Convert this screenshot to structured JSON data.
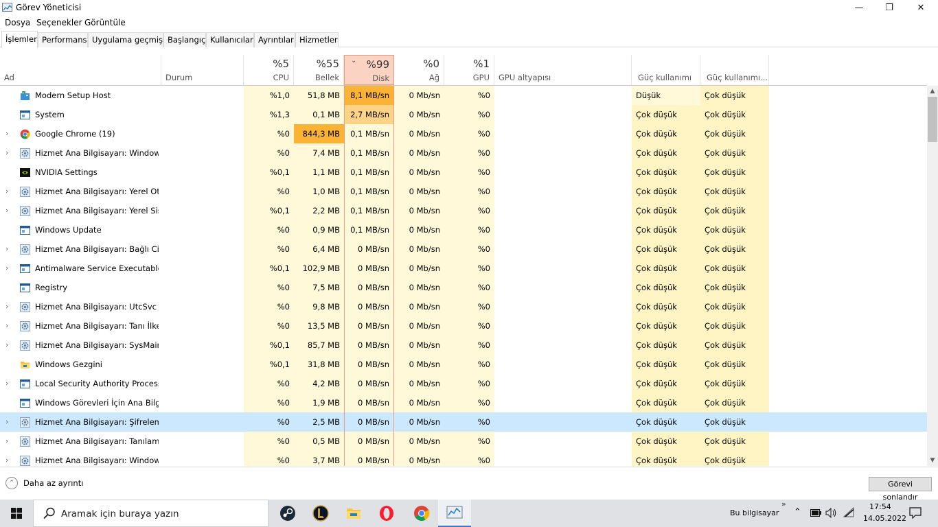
{
  "window": {
    "title": "Görev Yöneticisi",
    "minimize_glyph": "—",
    "maximize_glyph": "❐",
    "close_glyph": "✕"
  },
  "menu": [
    "Dosya",
    "Seçenekler",
    "Görüntüle"
  ],
  "tabs": [
    "İşlemler",
    "Performans",
    "Uygulama geçmişi",
    "Başlangıç",
    "Kullanıcılar",
    "Ayrıntılar",
    "Hizmetler"
  ],
  "active_tab": "İşlemler",
  "columns": {
    "name": "Ad",
    "status": "Durum",
    "cpu": {
      "pct": "%5",
      "label": "CPU"
    },
    "memory": {
      "pct": "%55",
      "label": "Bellek"
    },
    "disk": {
      "pct": "%99",
      "label": "Disk"
    },
    "network": {
      "pct": "%0",
      "label": "Ağ"
    },
    "gpu": {
      "pct": "%1",
      "label": "GPU"
    },
    "gpu_engine": "GPU altyapısı",
    "power": "Güç kullanımı",
    "power_trend": "Güç kullanımı..."
  },
  "rows": [
    {
      "name": "Modern Setup Host",
      "icon": "setup-icon",
      "expandable": false,
      "cpu": "%1,0",
      "mem": "51,8 MB",
      "disk": "8,1 MB/sn",
      "net": "0 Mb/sn",
      "gpu": "%0",
      "power": "Düşük",
      "trend": "Çok düşük",
      "disk_level": "high",
      "mem_level": "low",
      "power_level": "low"
    },
    {
      "name": "System",
      "icon": "window-icon",
      "expandable": false,
      "cpu": "%1,3",
      "mem": "0,1 MB",
      "disk": "2,7 MB/sn",
      "net": "0 Mb/sn",
      "gpu": "%0",
      "power": "Çok düşük",
      "trend": "Çok düşük",
      "disk_level": "mid",
      "mem_level": "low",
      "power_level": "verylow"
    },
    {
      "name": "Google Chrome (19)",
      "icon": "chrome-icon",
      "expandable": true,
      "cpu": "%0",
      "mem": "844,3 MB",
      "disk": "0,1 MB/sn",
      "net": "0 Mb/sn",
      "gpu": "%0",
      "power": "Çok düşük",
      "trend": "Çok düşük",
      "disk_level": "low",
      "mem_level": "high",
      "power_level": "verylow"
    },
    {
      "name": "Hizmet Ana Bilgisayarı: Window...",
      "icon": "gear-icon",
      "expandable": true,
      "cpu": "%0",
      "mem": "7,4 MB",
      "disk": "0,1 MB/sn",
      "net": "0 Mb/sn",
      "gpu": "%0",
      "power": "Çok düşük",
      "trend": "Çok düşük",
      "disk_level": "low",
      "mem_level": "low",
      "power_level": "verylow"
    },
    {
      "name": "NVIDIA Settings",
      "icon": "nvidia-icon",
      "expandable": false,
      "cpu": "%0,1",
      "mem": "1,1 MB",
      "disk": "0,1 MB/sn",
      "net": "0 Mb/sn",
      "gpu": "%0",
      "power": "Çok düşük",
      "trend": "Çok düşük",
      "disk_level": "low",
      "mem_level": "low",
      "power_level": "verylow"
    },
    {
      "name": "Hizmet Ana Bilgisayarı: Yerel Ot...",
      "icon": "gear-icon",
      "expandable": true,
      "cpu": "%0",
      "mem": "1,0 MB",
      "disk": "0,1 MB/sn",
      "net": "0 Mb/sn",
      "gpu": "%0",
      "power": "Çok düşük",
      "trend": "Çok düşük",
      "disk_level": "low",
      "mem_level": "low",
      "power_level": "verylow"
    },
    {
      "name": "Hizmet Ana Bilgisayarı: Yerel Sis...",
      "icon": "gear-icon",
      "expandable": true,
      "cpu": "%0,1",
      "mem": "2,2 MB",
      "disk": "0,1 MB/sn",
      "net": "0 Mb/sn",
      "gpu": "%0",
      "power": "Çok düşük",
      "trend": "Çok düşük",
      "disk_level": "low",
      "mem_level": "low",
      "power_level": "verylow"
    },
    {
      "name": "Windows Update",
      "icon": "window-icon",
      "expandable": false,
      "cpu": "%0",
      "mem": "0,9 MB",
      "disk": "0,1 MB/sn",
      "net": "0 Mb/sn",
      "gpu": "%0",
      "power": "Çok düşük",
      "trend": "Çok düşük",
      "disk_level": "low",
      "mem_level": "low",
      "power_level": "verylow"
    },
    {
      "name": "Hizmet Ana Bilgisayarı: Bağlı Ci...",
      "icon": "gear-icon",
      "expandable": true,
      "cpu": "%0",
      "mem": "6,4 MB",
      "disk": "0 MB/sn",
      "net": "0 Mb/sn",
      "gpu": "%0",
      "power": "Çok düşük",
      "trend": "Çok düşük",
      "disk_level": "low",
      "mem_level": "low",
      "power_level": "verylow"
    },
    {
      "name": "Antimalware Service Executable",
      "icon": "window-icon",
      "expandable": true,
      "cpu": "%0,1",
      "mem": "102,9 MB",
      "disk": "0 MB/sn",
      "net": "0 Mb/sn",
      "gpu": "%0",
      "power": "Çok düşük",
      "trend": "Çok düşük",
      "disk_level": "low",
      "mem_level": "low",
      "power_level": "verylow"
    },
    {
      "name": "Registry",
      "icon": "window-icon",
      "expandable": false,
      "cpu": "%0",
      "mem": "7,5 MB",
      "disk": "0 MB/sn",
      "net": "0 Mb/sn",
      "gpu": "%0",
      "power": "Çok düşük",
      "trend": "Çok düşük",
      "disk_level": "low",
      "mem_level": "low",
      "power_level": "verylow"
    },
    {
      "name": "Hizmet Ana Bilgisayarı: UtcSvc",
      "icon": "gear-icon",
      "expandable": true,
      "cpu": "%0",
      "mem": "9,8 MB",
      "disk": "0 MB/sn",
      "net": "0 Mb/sn",
      "gpu": "%0",
      "power": "Çok düşük",
      "trend": "Çok düşük",
      "disk_level": "low",
      "mem_level": "low",
      "power_level": "verylow"
    },
    {
      "name": "Hizmet Ana Bilgisayarı: Tanı İlke...",
      "icon": "gear-icon",
      "expandable": true,
      "cpu": "%0",
      "mem": "13,5 MB",
      "disk": "0 MB/sn",
      "net": "0 Mb/sn",
      "gpu": "%0",
      "power": "Çok düşük",
      "trend": "Çok düşük",
      "disk_level": "low",
      "mem_level": "low",
      "power_level": "verylow"
    },
    {
      "name": "Hizmet Ana Bilgisayarı: SysMain",
      "icon": "gear-icon",
      "expandable": true,
      "cpu": "%0,1",
      "mem": "85,7 MB",
      "disk": "0 MB/sn",
      "net": "0 Mb/sn",
      "gpu": "%0",
      "power": "Çok düşük",
      "trend": "Çok düşük",
      "disk_level": "low",
      "mem_level": "low",
      "power_level": "verylow"
    },
    {
      "name": "Windows Gezgini",
      "icon": "folder-icon",
      "expandable": false,
      "cpu": "%0,1",
      "mem": "31,8 MB",
      "disk": "0 MB/sn",
      "net": "0 Mb/sn",
      "gpu": "%0",
      "power": "Çok düşük",
      "trend": "Çok düşük",
      "disk_level": "low",
      "mem_level": "low",
      "power_level": "verylow"
    },
    {
      "name": "Local Security Authority Process...",
      "icon": "window-icon",
      "expandable": true,
      "cpu": "%0",
      "mem": "4,2 MB",
      "disk": "0 MB/sn",
      "net": "0 Mb/sn",
      "gpu": "%0",
      "power": "Çok düşük",
      "trend": "Çok düşük",
      "disk_level": "low",
      "mem_level": "low",
      "power_level": "verylow"
    },
    {
      "name": "Windows Görevleri İçin Ana Bilg...",
      "icon": "window-icon",
      "expandable": false,
      "cpu": "%0",
      "mem": "1,9 MB",
      "disk": "0 MB/sn",
      "net": "0 Mb/sn",
      "gpu": "%0",
      "power": "Çok düşük",
      "trend": "Çok düşük",
      "disk_level": "low",
      "mem_level": "low",
      "power_level": "verylow"
    },
    {
      "name": "Hizmet Ana Bilgisayarı: Şifrelem...",
      "icon": "gear-icon",
      "expandable": true,
      "selected": true,
      "cpu": "%0",
      "mem": "2,5 MB",
      "disk": "0 MB/sn",
      "net": "0 Mb/sn",
      "gpu": "%0",
      "power": "Çok düşük",
      "trend": "Çok düşük",
      "disk_level": "low",
      "mem_level": "low",
      "power_level": "verylow"
    },
    {
      "name": "Hizmet Ana Bilgisayarı: Tanılam...",
      "icon": "gear-icon",
      "expandable": true,
      "cpu": "%0",
      "mem": "0,5 MB",
      "disk": "0 MB/sn",
      "net": "0 Mb/sn",
      "gpu": "%0",
      "power": "Çok düşük",
      "trend": "Çok düşük",
      "disk_level": "low",
      "mem_level": "low",
      "power_level": "verylow"
    },
    {
      "name": "Hizmet Ana Bilgisayarı: Window...",
      "icon": "gear-icon",
      "expandable": true,
      "cpu": "%0",
      "mem": "3,7 MB",
      "disk": "0 MB/sn",
      "net": "0 Mb/sn",
      "gpu": "%0",
      "power": "Çok düşük",
      "trend": "Çok düşük",
      "disk_level": "low",
      "mem_level": "low",
      "power_level": "verylow"
    }
  ],
  "footer": {
    "fewer_details": "Daha az ayrıntı",
    "end_task": "Görevi sonlandır"
  },
  "taskbar": {
    "search_placeholder": "Aramak için buraya yazın",
    "apps": [
      "steam-icon",
      "league-icon",
      "file-explorer-icon",
      "opera-icon",
      "chrome-icon",
      "task-manager-icon"
    ],
    "location_label": "Bu bilgisayar",
    "time": "17:54",
    "date": "14.05.2022",
    "overflow_glyph": "»"
  },
  "colors": {
    "heat_verylow": "#fff4c4",
    "heat_low": "#fff9d9",
    "heat_mid": "#fdd388",
    "heat_high": "#fbb335",
    "disk_header": "#fbd3c3",
    "selected": "#cce8ff"
  }
}
